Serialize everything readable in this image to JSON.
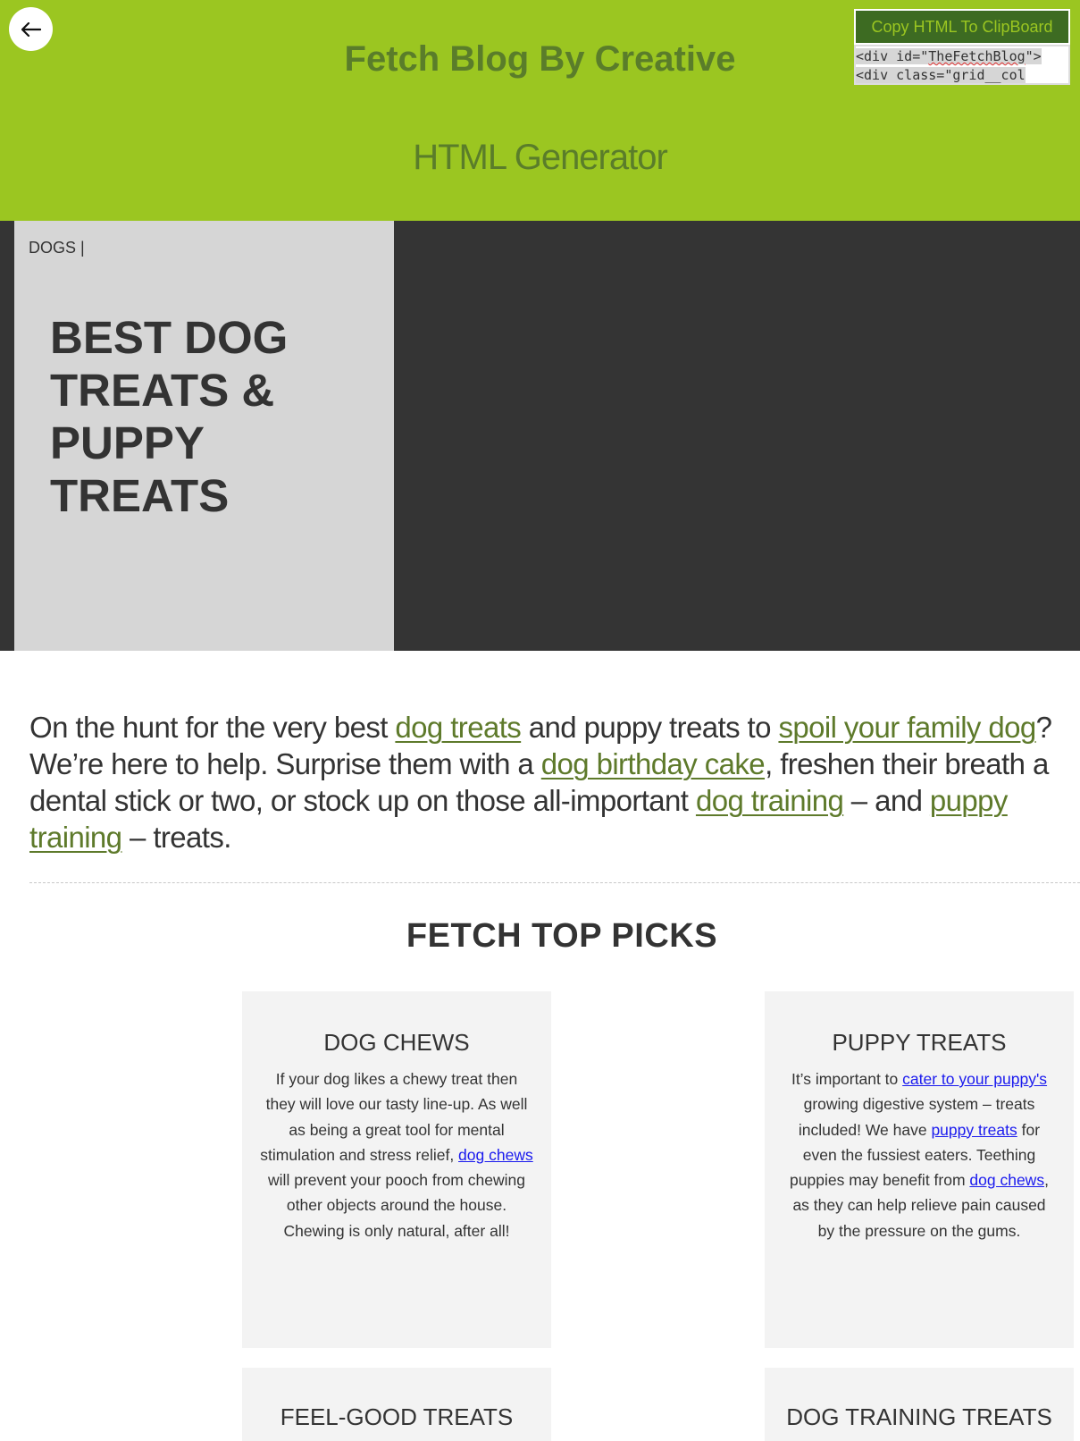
{
  "header": {
    "back_icon": "arrow-left-icon",
    "title": "Fetch Blog By Creative",
    "subtitle": "HTML Generator",
    "copy_button_label": "Copy HTML To ClipBoard",
    "code_line_1_pre": "<div id=\"",
    "code_line_1_word": "TheFetchBlog",
    "code_line_1_post": "\">",
    "code_line_2": "<div class=\"grid__col"
  },
  "hero": {
    "category": "DOGS |",
    "title": "BEST DOG TREATS & PUPPY TREATS"
  },
  "intro": {
    "t1": "On the hunt for the very best ",
    "l1": "dog treats",
    "t2": " and puppy treats to ",
    "l2": "spoil your family dog",
    "t3": "? We’re here to help. Surprise them with a ",
    "l3": "dog birthday cake",
    "t4": ", freshen their breath a dental stick or two, or stock up on those all-important ",
    "l4": "dog training",
    "t5": " – and ",
    "l5": "puppy training",
    "t6": " – treats."
  },
  "picks": {
    "title": "FETCH TOP PICKS",
    "cards": [
      {
        "title": "DOG CHEWS",
        "t1": "If your dog likes a chewy treat then they will love our tasty line-up. As well as being a great tool for mental stimulation and stress relief, ",
        "l1": "dog chews",
        "t2": " will prevent your pooch from chewing other objects around the house. Chewing is only natural, after all!"
      },
      {
        "title": "PUPPY TREATS",
        "t1": "It’s important to ",
        "l1": "cater to your puppy's",
        "t2": " growing digestive system – treats included! We have ",
        "l2": "puppy treats",
        "t3": " for even the fussiest eaters. Teething puppies may benefit from ",
        "l3": "dog chews",
        "t4": ", as they can help relieve pain caused by the pressure on the gums."
      },
      {
        "title": "FEEL-GOOD TREATS"
      },
      {
        "title": "DOG TRAINING TREATS"
      }
    ]
  },
  "colors": {
    "header_bg": "#9bc621",
    "header_text": "#5a7d2a",
    "copy_button_bg": "#3d6b22",
    "hero_bg": "#343434",
    "hero_card_bg": "#d6d6d6",
    "intro_link": "#5e7a2b",
    "card_bg": "#f3f3f3",
    "card_link": "#1a1aee"
  }
}
